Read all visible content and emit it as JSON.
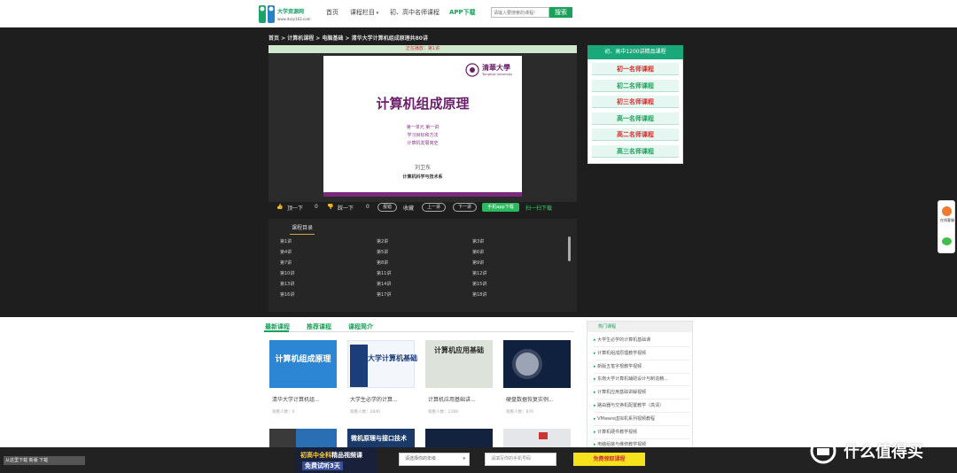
{
  "header": {
    "logo_title": "大学资源网",
    "logo_url": "www.dxzy163.com",
    "nav": [
      "首页",
      "课程栏目",
      "初、高中名师课程",
      "APP下载"
    ],
    "search_placeholder": "请输入要搜索的课程!",
    "search_button": "搜索"
  },
  "breadcrumb": "首页 > 计算机课程 > 电脑基础 > 清华大学计算机组成原理共80讲",
  "player": {
    "progress_text": "正在播放：第1讲",
    "slide": {
      "logo_text": "清華大學",
      "logo_sub": "Tsinghua University",
      "title": "计算机组成原理",
      "line1": "第一单元    第一讲",
      "line2": "学习目标和方法",
      "line3": "计算机发展简史",
      "author": "刘卫东",
      "dept": "计算机科学与技术系"
    },
    "controls": {
      "up": "顶一下",
      "up_count": "0",
      "down": "踩一下",
      "down_count": "0",
      "report": "报错",
      "fav": "收藏",
      "prev": "上一讲",
      "next": "下一讲",
      "app": "手机app下载",
      "scan": "扫一扫下载"
    }
  },
  "catalog": {
    "title": "课程目录",
    "lessons": [
      "第1讲",
      "第2讲",
      "第3讲",
      "第4讲",
      "第5讲",
      "第6讲",
      "第7讲",
      "第8讲",
      "第9讲",
      "第10讲",
      "第11讲",
      "第12讲",
      "第13讲",
      "第14讲",
      "第15讲",
      "第16讲",
      "第17讲",
      "第18讲"
    ]
  },
  "right_panel": {
    "head": "初、高中1200讲精品课程",
    "buttons": [
      {
        "label": "初一名师课程",
        "color": "#d92b2b"
      },
      {
        "label": "初二名师课程",
        "color": "#19a15a"
      },
      {
        "label": "初三名师课程",
        "color": "#d92b2b"
      },
      {
        "label": "高一名师课程",
        "color": "#19a15a"
      },
      {
        "label": "高二名师课程",
        "color": "#d92b2b"
      },
      {
        "label": "高三名师课程",
        "color": "#19a15a"
      }
    ]
  },
  "float": {
    "service": "在线客服"
  },
  "tabs": [
    "最新课程",
    "推荐课程",
    "课程简介"
  ],
  "cards": [
    {
      "title": "清华大学计算机组...",
      "meta": "观看人数：0",
      "thumb_text": "计算机组成原理"
    },
    {
      "title": "大学生必学的计算...",
      "meta": "观看人数：2846",
      "thumb_text": "大学计算机基础"
    },
    {
      "title": "计算机应用基础讲...",
      "meta": "观看人数：1289",
      "thumb_text": "计算机应用基础"
    },
    {
      "title": "硬盘数据恢复实例...",
      "meta": "观看人数：876",
      "thumb_text": ""
    }
  ],
  "second_row": [
    "",
    "微机原理与接口技术",
    "",
    ""
  ],
  "hot": {
    "title": "热门课程",
    "items": [
      "大学生必学的计算机基础课",
      "计算机组成原理教学视频",
      "新版五笔字根教学视频",
      "东南大学计算机辅助设计与制造精...",
      "计算机应用基础讲解视频",
      "路由器与交换机配置教学（高清）",
      "VMware虚拟机系列视频教程",
      "计算机硬件教学视频",
      "电脑组装与维修教学视频"
    ]
  },
  "bottom_bar": {
    "left": "从这里下载 新版 下载",
    "promo_line1_prefix": "初高中全科",
    "promo_line1_suffix": "精品视频课",
    "promo_line2": "免费试听3天",
    "grade_placeholder": "请选择你的年级",
    "phone_placeholder": "请填写你的手机号码",
    "cta": "免费领取课程"
  },
  "watermark": "什么值得买"
}
